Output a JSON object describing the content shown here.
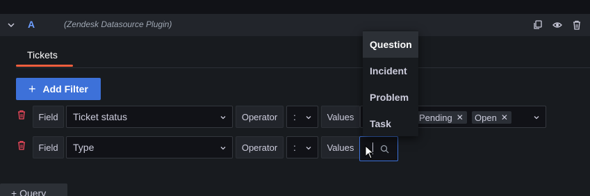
{
  "query_row": {
    "ref_id": "A",
    "plugin_name": "(Zendesk Datasource Plugin)",
    "icons": [
      "chevron-down-icon",
      "duplicate-icon",
      "eye-icon",
      "trash-icon"
    ]
  },
  "tabs": [
    {
      "label": "Tickets",
      "active": true
    }
  ],
  "add_filter_label": "Add Filter",
  "filters": [
    {
      "field_label": "Field",
      "field_value": "Ticket status",
      "operator_label": "Operator",
      "operator_value": ":",
      "values_label": "Values",
      "chips": [
        "Pending",
        "Open"
      ]
    },
    {
      "field_label": "Field",
      "field_value": "Type",
      "operator_label": "Operator",
      "operator_value": ":",
      "values_label": "Values"
    }
  ],
  "dropdown_options": [
    "Question",
    "Incident",
    "Problem",
    "Task"
  ],
  "dropdown_highlighted": "Question",
  "add_query_label": "Query",
  "colors": {
    "accent_blue": "#3d71d9",
    "tab_underline": "#f55f3e",
    "trash_red": "#f2495c",
    "ref_id": "#6e9fff"
  }
}
